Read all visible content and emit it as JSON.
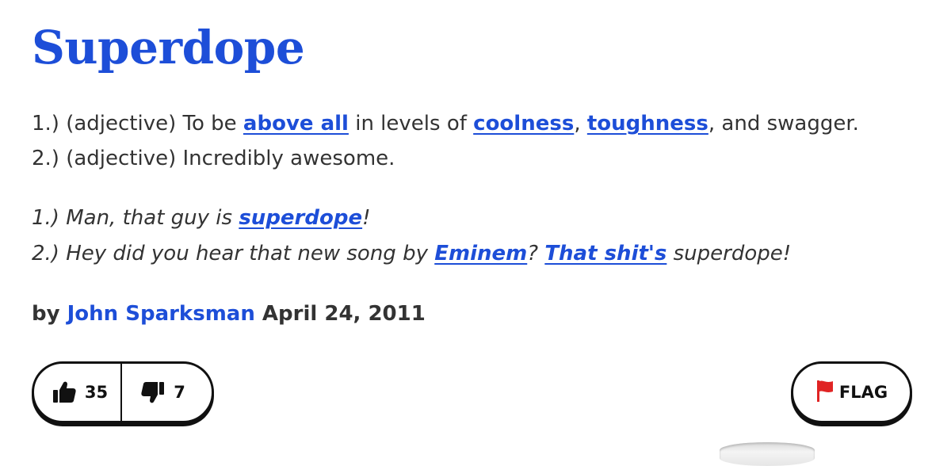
{
  "definition": {
    "word": "Superdope",
    "meaning_lines": [
      [
        {
          "text": "1.) (adjective) To be "
        },
        {
          "text": "above all",
          "link": true
        },
        {
          "text": " in levels of "
        },
        {
          "text": "coolness",
          "link": true
        },
        {
          "text": ", "
        },
        {
          "text": "toughness",
          "link": true
        },
        {
          "text": ", and swagger."
        }
      ],
      [
        {
          "text": "2.) (adjective) Incredibly awesome."
        }
      ]
    ],
    "example_lines": [
      [
        {
          "text": "1.) Man, that guy is "
        },
        {
          "text": "superdope",
          "link": true
        },
        {
          "text": "!"
        }
      ],
      [
        {
          "text": "2.) Hey did you hear that new song by "
        },
        {
          "text": "Eminem",
          "link": true
        },
        {
          "text": "? "
        },
        {
          "text": "That shit's",
          "link": true
        },
        {
          "text": " superdope!"
        }
      ]
    ],
    "contributor": {
      "by_label": "by",
      "author": "John Sparksman",
      "date": "April 24, 2011"
    },
    "votes": {
      "up": "35",
      "down": "7",
      "up_icon": "thumbs-up-icon",
      "down_icon": "thumbs-down-icon"
    },
    "flag": {
      "label": "FLAG",
      "icon": "red-flag-icon",
      "icon_color": "#e02424"
    }
  },
  "colors": {
    "link": "#1d4ed8",
    "text": "#333333",
    "border": "#111111"
  }
}
